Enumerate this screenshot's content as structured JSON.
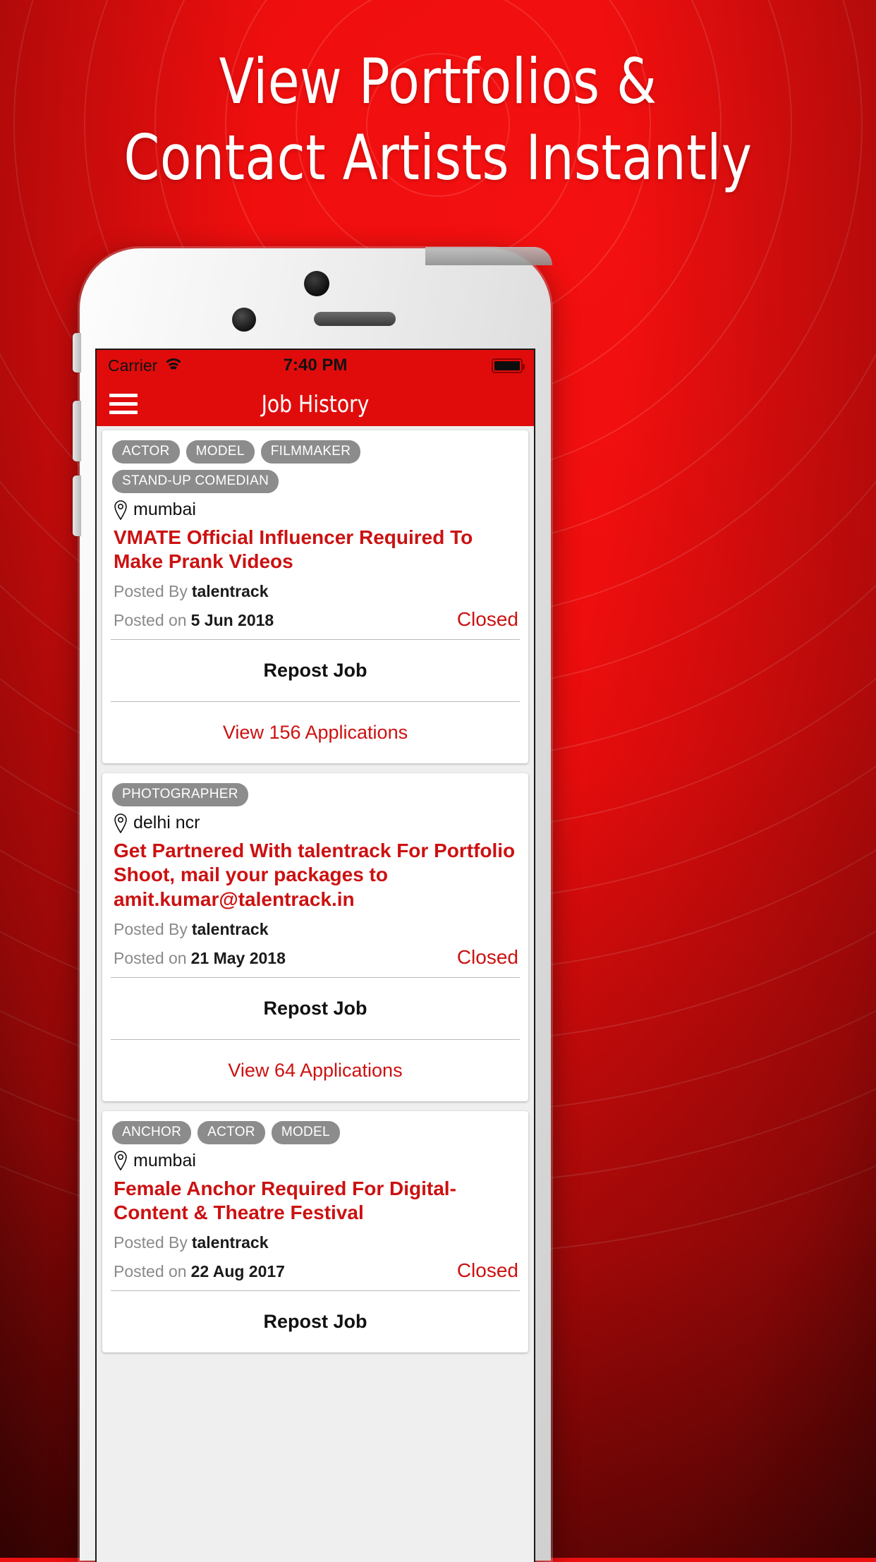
{
  "promo": {
    "line1": "View Portfolios &",
    "line2": "Contact Artists Instantly"
  },
  "statusbar": {
    "carrier": "Carrier",
    "wifi_icon": "wifi-icon",
    "time": "7:40 PM",
    "battery_icon": "battery-full-icon"
  },
  "navbar": {
    "menu_icon": "hamburger-menu-icon",
    "title": "Job History"
  },
  "colors": {
    "brand_red": "#e00c0c",
    "title_red": "#cc1111",
    "tag_gray": "#8c8c8c",
    "meta_gray": "#8a8a8a"
  },
  "labels": {
    "posted_by": "Posted By",
    "posted_on": "Posted on",
    "location_icon": "location-pin-icon"
  },
  "jobs": [
    {
      "tags": [
        "ACTOR",
        "MODEL",
        "FILMMAKER",
        "STAND-UP COMEDIAN"
      ],
      "location": "mumbai",
      "title": "VMATE Official Influencer Required To Make Prank Videos",
      "posted_by": "talentrack",
      "posted_on": "5 Jun 2018",
      "status": "Closed",
      "repost_label": "Repost Job",
      "applications_label": "View 156 Applications"
    },
    {
      "tags": [
        "PHOTOGRAPHER"
      ],
      "location": "delhi ncr",
      "title": "Get Partnered With talentrack For Portfolio Shoot, mail your packages to amit.kumar@talentrack.in",
      "posted_by": "talentrack",
      "posted_on": "21 May 2018",
      "status": "Closed",
      "repost_label": "Repost Job",
      "applications_label": "View 64 Applications"
    },
    {
      "tags": [
        "ANCHOR",
        "ACTOR",
        "MODEL"
      ],
      "location": "mumbai",
      "title": "Female Anchor Required For Digital-Content & Theatre Festival",
      "posted_by": "talentrack",
      "posted_on": "22 Aug 2017",
      "status": "Closed",
      "repost_label": "Repost Job",
      "applications_label": ""
    }
  ]
}
